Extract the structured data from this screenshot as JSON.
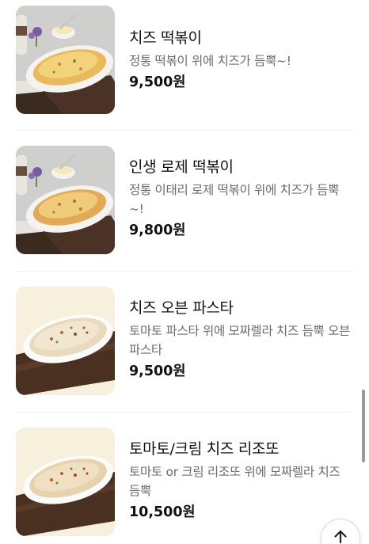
{
  "menu": {
    "items": [
      {
        "name": "치즈 떡볶이",
        "description": "정통 떡볶이 위에 치즈가 듬뿍~!",
        "price": "9,500원",
        "photo": "cheese-tteokbokki-gratin-dish"
      },
      {
        "name": "인생 로제 떡볶이",
        "description": "정통 이태리 로제 떡볶이 위에 치즈가 듬뿍~!",
        "price": "9,800원",
        "photo": "rose-tteokbokki-gratin-dish"
      },
      {
        "name": "치즈 오븐 파스타",
        "description": "토마토 파스타 위에 모짜렐라 치즈 듬뿍 오븐 파스타",
        "price": "9,500원",
        "photo": "cheese-oven-pasta-dish"
      },
      {
        "name": "토마토/크림 치즈 리조또",
        "description": "토마토 or 크림 리조또 위에 모짜렐라 치즈 듬뿍",
        "price": "10,500원",
        "photo": "tomato-cream-cheese-risotto-dish"
      }
    ]
  },
  "scroll_to_top": {
    "icon": "arrow-up-icon"
  }
}
